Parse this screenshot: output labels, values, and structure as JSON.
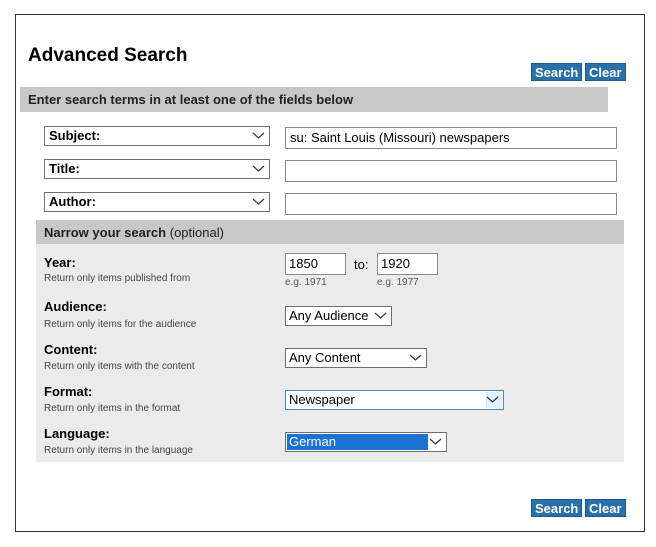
{
  "page": {
    "title": "Advanced Search",
    "search_label": "Search",
    "clear_label": "Clear"
  },
  "terms_bar": "Enter search terms in at least one of the fields below",
  "term_rows": [
    {
      "field": "Subject:",
      "value": "su: Saint Louis (Missouri) newspapers"
    },
    {
      "field": "Title:",
      "value": ""
    },
    {
      "field": "Author:",
      "value": ""
    }
  ],
  "narrow_bar": {
    "bold": "Narrow your search",
    "optional": "(optional)"
  },
  "year": {
    "label": "Year:",
    "help": "Return only items published from",
    "from": "1850",
    "to_label": "to:",
    "to": "1920",
    "from_hint": "e.g. 1971",
    "to_hint": "e.g. 1977"
  },
  "audience": {
    "label": "Audience:",
    "help": "Return only items for the audience",
    "value": "Any Audience"
  },
  "content": {
    "label": "Content:",
    "help": "Return only items with the content",
    "value": "Any Content"
  },
  "format": {
    "label": "Format:",
    "help": "Return only items in the format",
    "value": "Newspaper"
  },
  "language": {
    "label": "Language:",
    "help": "Return only items in the language",
    "value": "German"
  },
  "colors": {
    "button": "#2a6fa8",
    "bar": "#c8c8c8",
    "narrow_bg": "#ebebeb",
    "selected": "#1a73d0"
  }
}
